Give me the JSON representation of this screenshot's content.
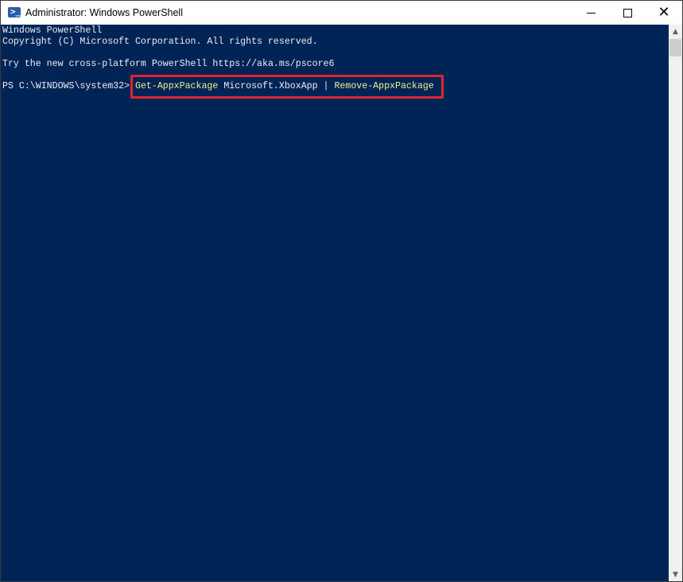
{
  "window": {
    "title": "Administrator: Windows PowerShell",
    "icon": "powershell-icon",
    "controls": {
      "minimize": "minimize-icon",
      "maximize": "maximize-icon",
      "close": "close-icon"
    }
  },
  "console": {
    "lines": [
      "Windows PowerShell",
      "Copyright (C) Microsoft Corporation. All rights reserved.",
      "",
      "Try the new cross-platform PowerShell https://aka.ms/pscore6"
    ],
    "prompt": "PS C:\\WINDOWS\\system32> ",
    "command": {
      "cmdlet1": "Get-AppxPackage",
      "arg": " Microsoft.XboxApp | ",
      "cmdlet2": "Remove-AppxPackage"
    },
    "colors": {
      "background": "#012456",
      "text": "#eeedf0",
      "cmdlet": "#f0f08a",
      "highlight": "#e0242d"
    }
  },
  "scrollbar": {
    "up": "chevron-up-icon",
    "down": "chevron-down-icon"
  }
}
